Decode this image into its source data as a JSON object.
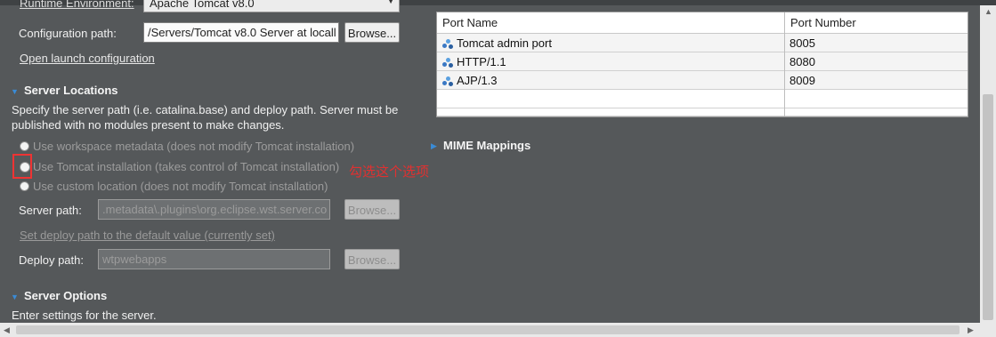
{
  "top": {
    "runtime_label": "Runtime Environment:",
    "runtime_value": "Apache Tomcat v8.0"
  },
  "config": {
    "label": "Configuration path:",
    "value": "/Servers/Tomcat v8.0 Server at locall",
    "browse": "Browse...",
    "open_launch": "Open launch configuration"
  },
  "server_locations": {
    "title": "Server Locations",
    "desc_line1": "Specify the server path (i.e. catalina.base) and deploy path. Server must be",
    "desc_line2": "published with no modules present to make changes.",
    "options": [
      {
        "label": "Use workspace metadata (does not modify Tomcat installation)",
        "selected": true
      },
      {
        "label": "Use Tomcat installation (takes control of Tomcat installation)",
        "selected": false
      },
      {
        "label": "Use custom location (does not modify Tomcat installation)",
        "selected": false
      }
    ],
    "server_path_label": "Server path:",
    "server_path_value": ".metadata\\.plugins\\org.eclipse.wst.server.co",
    "browse": "Browse...",
    "set_deploy_link": "Set deploy path to the default value (currently set)",
    "deploy_path_label": "Deploy path:",
    "deploy_path_value": "wtpwebapps",
    "annotation": "勾选这个选项"
  },
  "server_options": {
    "title": "Server Options",
    "desc": "Enter settings for the server."
  },
  "ports": {
    "headers": [
      "Port Name",
      "Port Number"
    ],
    "rows": [
      {
        "name": "Tomcat admin port",
        "number": "8005"
      },
      {
        "name": "HTTP/1.1",
        "number": "8080"
      },
      {
        "name": "AJP/1.3",
        "number": "8009"
      }
    ]
  },
  "mime": {
    "title": "MIME Mappings"
  },
  "colors": {
    "background": "#55585a",
    "accent_triangle": "#3a8bd6",
    "annotation_red": "#e23030"
  }
}
